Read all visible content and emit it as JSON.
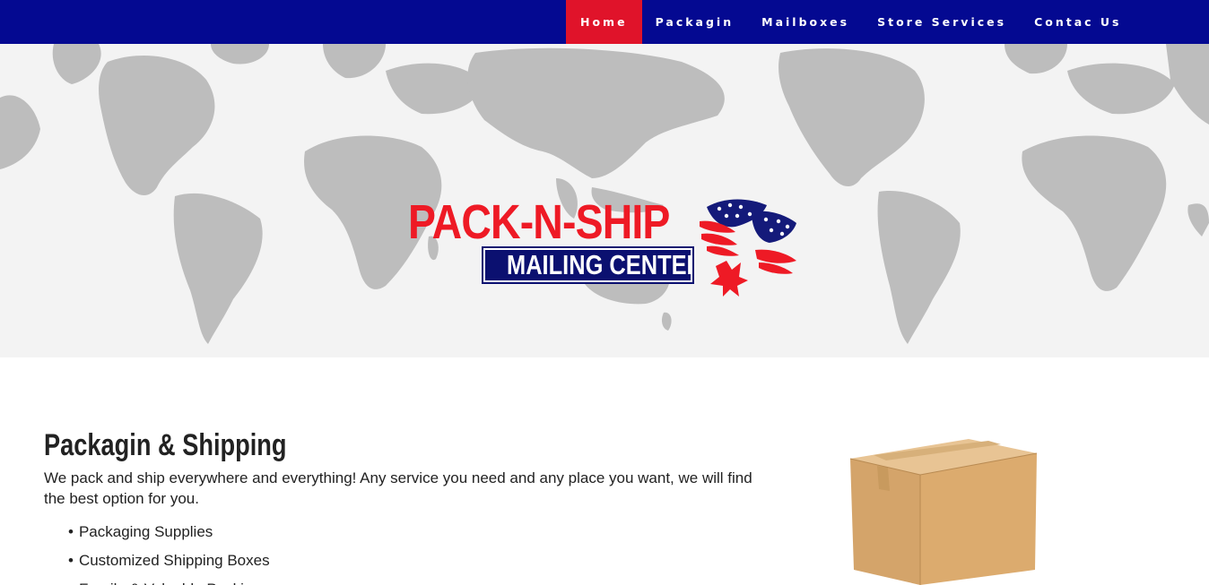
{
  "nav": {
    "items": [
      {
        "label": "Home",
        "active": true
      },
      {
        "label": "Packagin",
        "active": false
      },
      {
        "label": "Mailboxes",
        "active": false
      },
      {
        "label": "Store Services",
        "active": false
      },
      {
        "label": "Contac Us",
        "active": false
      }
    ]
  },
  "logo": {
    "title": "PACK-N-SHIP",
    "subtitle": "MAILING CENTER"
  },
  "section": {
    "title": "Packagin & Shipping",
    "description": "We pack and ship everywhere and everything! Any service you need and any place you want, we will find the best option for you.",
    "features": [
      "Packaging Supplies",
      "Customized Shipping Boxes",
      "Fragile & Valuable Packing"
    ]
  },
  "colors": {
    "nav_bg": "#040991",
    "nav_active": "#e0132a",
    "logo_red": "#ee1a25",
    "logo_blue": "#0b1070",
    "map_land": "#bdbdbd",
    "hero_bg": "#f3f3f3"
  }
}
